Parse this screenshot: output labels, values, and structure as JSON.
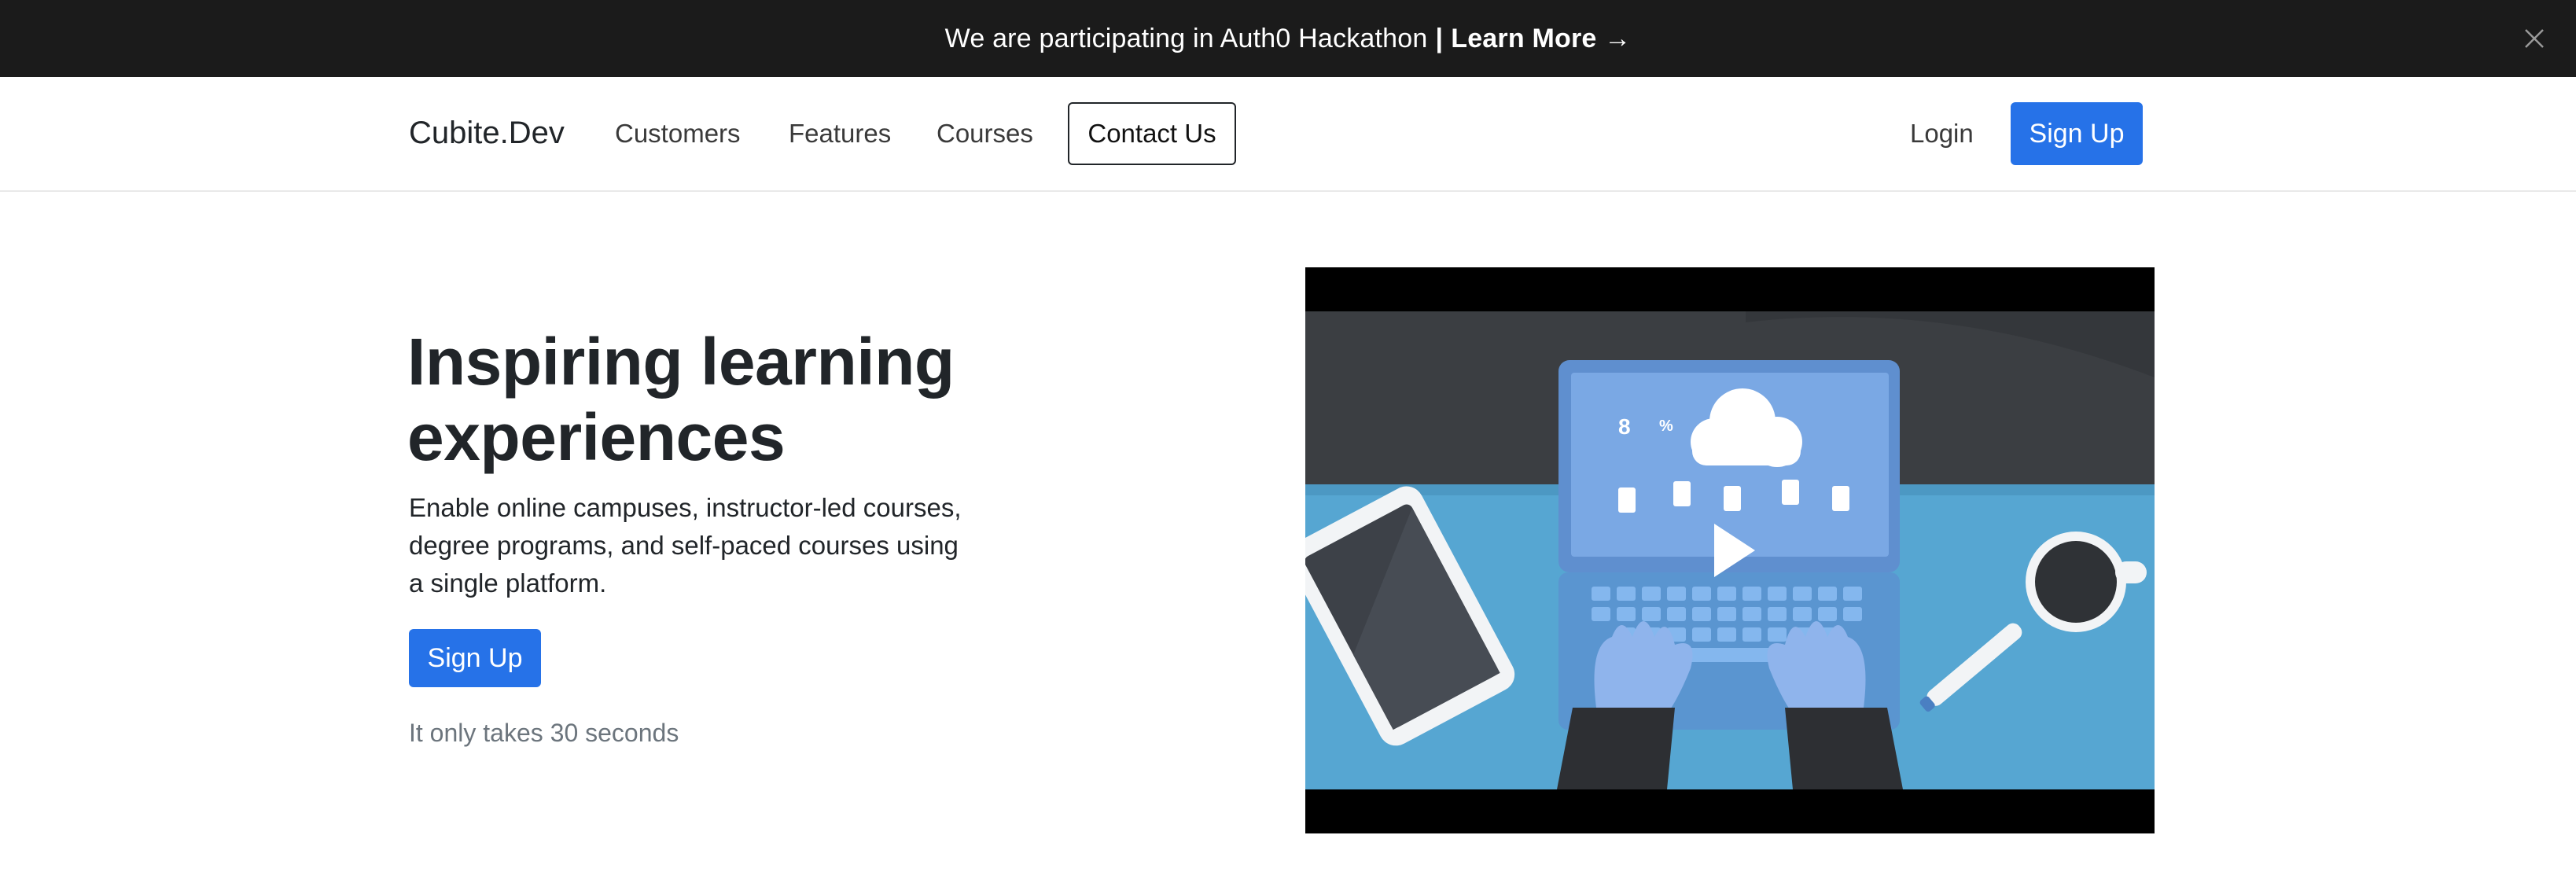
{
  "banner": {
    "text": "We are participating in Auth0 Hackathon",
    "separator": "|",
    "link_text": "Learn More →"
  },
  "nav": {
    "brand": "Cubite.Dev",
    "links": [
      "Customers",
      "Features",
      "Courses"
    ],
    "contact": "Contact Us",
    "login": "Login",
    "signup": "Sign Up"
  },
  "hero": {
    "title_line1": "Inspiring learning",
    "title_line2": "experiences",
    "desc_line1": "Enable online campuses, instructor-led courses,",
    "desc_line2": "degree programs, and self-paced courses using",
    "desc_line3": "a single platform.",
    "signup": "Sign Up",
    "note": "It only takes 30 seconds"
  },
  "video": {
    "screen_text_8": "8",
    "screen_text_pct": "%"
  },
  "colors": {
    "banner_bg": "#1b1b1b",
    "primary": "#2672e8",
    "muted": "#6c757d",
    "desk": "#56a6d2"
  }
}
